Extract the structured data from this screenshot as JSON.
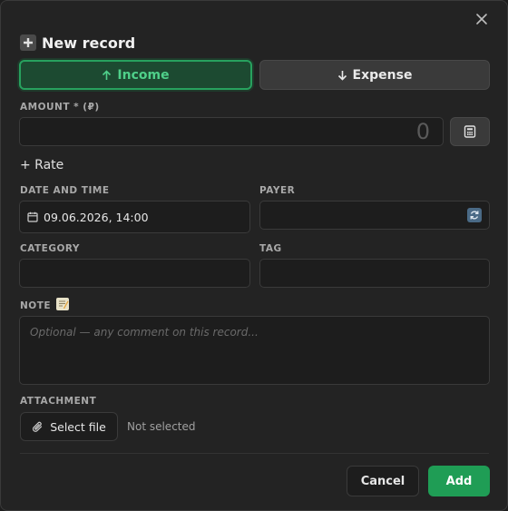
{
  "dialog": {
    "title": "New record",
    "close_icon": "close-icon"
  },
  "type_toggle": {
    "income_label": "Income",
    "expense_label": "Expense",
    "selected": "income"
  },
  "amount": {
    "label": "AMOUNT * (₽)",
    "value": "0",
    "calculator_icon": "calculator-icon"
  },
  "rate_link": "+ Rate",
  "date_time": {
    "label": "DATE AND TIME",
    "value": "09.06.2026, 14:00"
  },
  "payer": {
    "label": "PAYER",
    "value": ""
  },
  "category": {
    "label": "CATEGORY",
    "value": ""
  },
  "tag": {
    "label": "TAG",
    "value": ""
  },
  "note": {
    "label": "NOTE",
    "placeholder": "Optional — any comment on this record..."
  },
  "attachment": {
    "label": "ATTACHMENT",
    "button_label": "Select file",
    "status": "Not selected"
  },
  "actions": {
    "cancel_label": "Cancel",
    "add_label": "Add"
  },
  "colors": {
    "income_accent": "#27a15e",
    "add_button": "#1f9d55",
    "background": "#232323"
  }
}
